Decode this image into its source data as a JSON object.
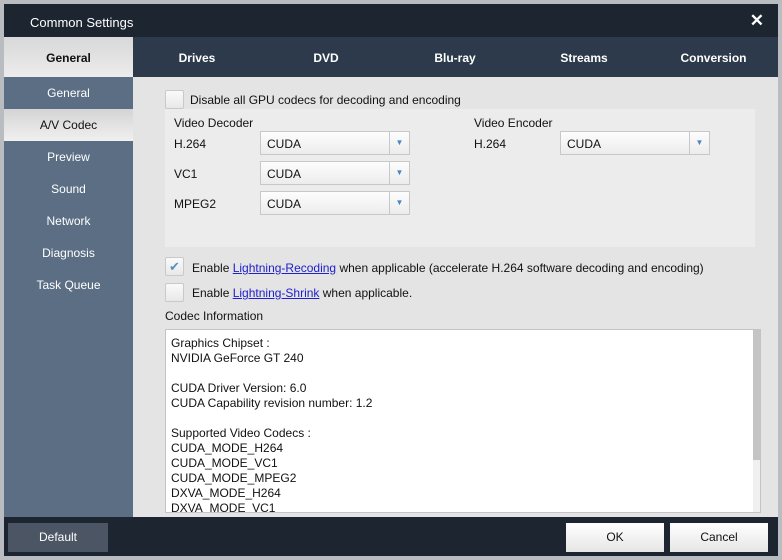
{
  "window": {
    "title": "Common Settings",
    "close_icon": "close-icon"
  },
  "tabs": [
    "General",
    "Drives",
    "DVD",
    "Blu-ray",
    "Streams",
    "Conversion"
  ],
  "sidebar": [
    "General",
    "A/V Codec",
    "Preview",
    "Sound",
    "Network",
    "Diagnosis",
    "Task Queue"
  ],
  "codec": {
    "disable_gpu": "Disable all GPU codecs for decoding and encoding",
    "decoder_title": "Video Decoder",
    "decoders": [
      {
        "label": "H.264",
        "value": "CUDA"
      },
      {
        "label": "VC1",
        "value": "CUDA"
      },
      {
        "label": "MPEG2",
        "value": "CUDA"
      }
    ],
    "encoder_title": "Video Encoder",
    "encoders": [
      {
        "label": "H.264",
        "value": "CUDA"
      }
    ],
    "recoding": {
      "pre": "Enable ",
      "link": "Lightning-Recoding",
      "post": " when applicable (accelerate H.264 software decoding and encoding)",
      "checked": true
    },
    "shrink": {
      "pre": "Enable ",
      "link": "Lightning-Shrink",
      "post": " when applicable.",
      "checked": false
    },
    "info_title": "Codec Information",
    "info_lines": [
      "Graphics Chipset :",
      "NVIDIA GeForce GT 240",
      "",
      "CUDA Driver Version: 6.0",
      "CUDA Capability revision number: 1.2",
      "",
      "Supported Video Codecs :",
      "CUDA_MODE_H264",
      "CUDA_MODE_VC1",
      "CUDA_MODE_MPEG2",
      "DXVA_MODE_H264",
      "DXVA_MODE_VC1"
    ]
  },
  "footer": {
    "default": "Default",
    "ok": "OK",
    "cancel": "Cancel"
  }
}
